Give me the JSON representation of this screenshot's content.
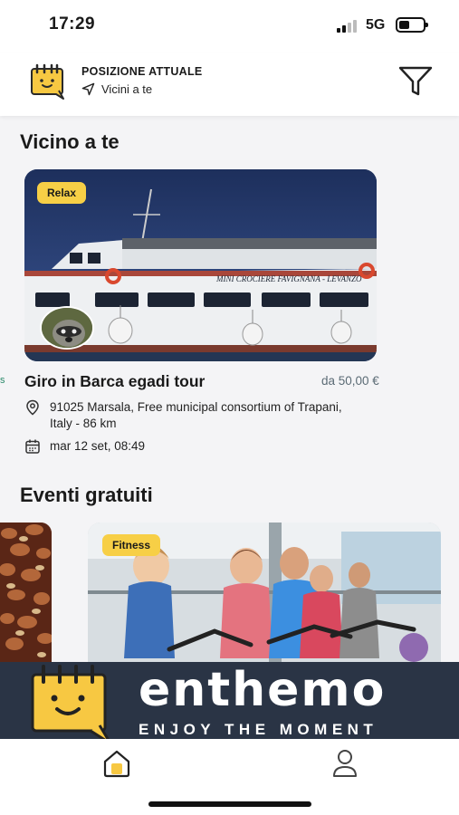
{
  "status_bar": {
    "time": "17:29",
    "network": "5G"
  },
  "header": {
    "location_title": "POSIZIONE ATTUALE",
    "location_value": "Vicini a te",
    "icons": [
      "location-arrow-icon",
      "filter-icon"
    ]
  },
  "sections": {
    "nearby": {
      "title": "Vicino a te",
      "event": {
        "tag": "Relax",
        "title": "Giro in Barca egadi tour",
        "price": "da 50,00 €",
        "address": "91025 Marsala, Free municipal consortium of Trapani, Italy - 86 km",
        "date": "mar 12 set, 08:49",
        "boat_text": "MINI CROCIERE FAVIGNANA - LEVANZO"
      }
    },
    "free_events": {
      "title": "Eventi gratuiti",
      "cards": [
        {
          "tag": "Fitness"
        }
      ]
    }
  },
  "banner": {
    "brand": "enthemo",
    "tagline": "ENJOY THE MOMENT"
  },
  "bottom_nav": {
    "items": [
      "home-icon",
      "profile-icon"
    ]
  },
  "colors": {
    "accent": "#f7cf46",
    "banner_bg": "#2a3445"
  }
}
